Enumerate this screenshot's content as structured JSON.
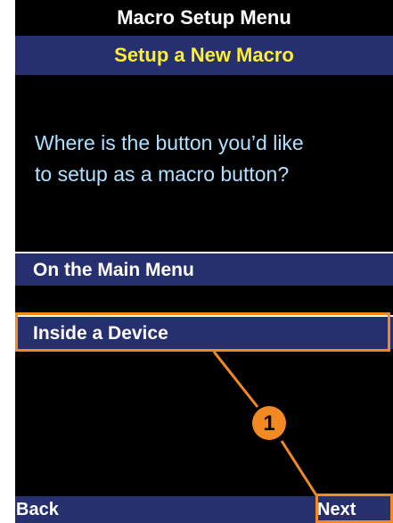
{
  "header": {
    "title": "Macro Setup Menu",
    "subtitle": "Setup a New Macro"
  },
  "prompt": {
    "line1": "Where is the button you’d like",
    "line2": "to setup as a macro button?"
  },
  "options": [
    {
      "label": "On the Main Menu"
    },
    {
      "label": "Inside a Device"
    }
  ],
  "softkeys": {
    "back": "Back",
    "next": "Next"
  },
  "callout": {
    "number": "1",
    "color": "#f28a24"
  },
  "colors": {
    "screen_bg": "#000000",
    "bar_bg": "#27306e",
    "subtitle_text": "#ffef2d",
    "prompt_text": "#aee0ff"
  }
}
